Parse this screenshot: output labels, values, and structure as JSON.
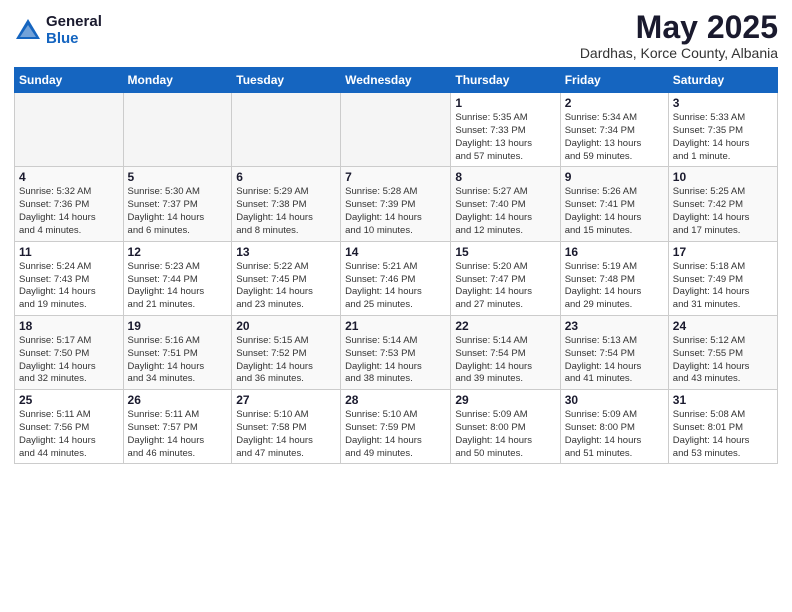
{
  "header": {
    "logo_general": "General",
    "logo_blue": "Blue",
    "main_title": "May 2025",
    "subtitle": "Dardhas, Korce County, Albania"
  },
  "weekdays": [
    "Sunday",
    "Monday",
    "Tuesday",
    "Wednesday",
    "Thursday",
    "Friday",
    "Saturday"
  ],
  "weeks": [
    [
      {
        "day": "",
        "info": ""
      },
      {
        "day": "",
        "info": ""
      },
      {
        "day": "",
        "info": ""
      },
      {
        "day": "",
        "info": ""
      },
      {
        "day": "1",
        "info": "Sunrise: 5:35 AM\nSunset: 7:33 PM\nDaylight: 13 hours\nand 57 minutes."
      },
      {
        "day": "2",
        "info": "Sunrise: 5:34 AM\nSunset: 7:34 PM\nDaylight: 13 hours\nand 59 minutes."
      },
      {
        "day": "3",
        "info": "Sunrise: 5:33 AM\nSunset: 7:35 PM\nDaylight: 14 hours\nand 1 minute."
      }
    ],
    [
      {
        "day": "4",
        "info": "Sunrise: 5:32 AM\nSunset: 7:36 PM\nDaylight: 14 hours\nand 4 minutes."
      },
      {
        "day": "5",
        "info": "Sunrise: 5:30 AM\nSunset: 7:37 PM\nDaylight: 14 hours\nand 6 minutes."
      },
      {
        "day": "6",
        "info": "Sunrise: 5:29 AM\nSunset: 7:38 PM\nDaylight: 14 hours\nand 8 minutes."
      },
      {
        "day": "7",
        "info": "Sunrise: 5:28 AM\nSunset: 7:39 PM\nDaylight: 14 hours\nand 10 minutes."
      },
      {
        "day": "8",
        "info": "Sunrise: 5:27 AM\nSunset: 7:40 PM\nDaylight: 14 hours\nand 12 minutes."
      },
      {
        "day": "9",
        "info": "Sunrise: 5:26 AM\nSunset: 7:41 PM\nDaylight: 14 hours\nand 15 minutes."
      },
      {
        "day": "10",
        "info": "Sunrise: 5:25 AM\nSunset: 7:42 PM\nDaylight: 14 hours\nand 17 minutes."
      }
    ],
    [
      {
        "day": "11",
        "info": "Sunrise: 5:24 AM\nSunset: 7:43 PM\nDaylight: 14 hours\nand 19 minutes."
      },
      {
        "day": "12",
        "info": "Sunrise: 5:23 AM\nSunset: 7:44 PM\nDaylight: 14 hours\nand 21 minutes."
      },
      {
        "day": "13",
        "info": "Sunrise: 5:22 AM\nSunset: 7:45 PM\nDaylight: 14 hours\nand 23 minutes."
      },
      {
        "day": "14",
        "info": "Sunrise: 5:21 AM\nSunset: 7:46 PM\nDaylight: 14 hours\nand 25 minutes."
      },
      {
        "day": "15",
        "info": "Sunrise: 5:20 AM\nSunset: 7:47 PM\nDaylight: 14 hours\nand 27 minutes."
      },
      {
        "day": "16",
        "info": "Sunrise: 5:19 AM\nSunset: 7:48 PM\nDaylight: 14 hours\nand 29 minutes."
      },
      {
        "day": "17",
        "info": "Sunrise: 5:18 AM\nSunset: 7:49 PM\nDaylight: 14 hours\nand 31 minutes."
      }
    ],
    [
      {
        "day": "18",
        "info": "Sunrise: 5:17 AM\nSunset: 7:50 PM\nDaylight: 14 hours\nand 32 minutes."
      },
      {
        "day": "19",
        "info": "Sunrise: 5:16 AM\nSunset: 7:51 PM\nDaylight: 14 hours\nand 34 minutes."
      },
      {
        "day": "20",
        "info": "Sunrise: 5:15 AM\nSunset: 7:52 PM\nDaylight: 14 hours\nand 36 minutes."
      },
      {
        "day": "21",
        "info": "Sunrise: 5:14 AM\nSunset: 7:53 PM\nDaylight: 14 hours\nand 38 minutes."
      },
      {
        "day": "22",
        "info": "Sunrise: 5:14 AM\nSunset: 7:54 PM\nDaylight: 14 hours\nand 39 minutes."
      },
      {
        "day": "23",
        "info": "Sunrise: 5:13 AM\nSunset: 7:54 PM\nDaylight: 14 hours\nand 41 minutes."
      },
      {
        "day": "24",
        "info": "Sunrise: 5:12 AM\nSunset: 7:55 PM\nDaylight: 14 hours\nand 43 minutes."
      }
    ],
    [
      {
        "day": "25",
        "info": "Sunrise: 5:11 AM\nSunset: 7:56 PM\nDaylight: 14 hours\nand 44 minutes."
      },
      {
        "day": "26",
        "info": "Sunrise: 5:11 AM\nSunset: 7:57 PM\nDaylight: 14 hours\nand 46 minutes."
      },
      {
        "day": "27",
        "info": "Sunrise: 5:10 AM\nSunset: 7:58 PM\nDaylight: 14 hours\nand 47 minutes."
      },
      {
        "day": "28",
        "info": "Sunrise: 5:10 AM\nSunset: 7:59 PM\nDaylight: 14 hours\nand 49 minutes."
      },
      {
        "day": "29",
        "info": "Sunrise: 5:09 AM\nSunset: 8:00 PM\nDaylight: 14 hours\nand 50 minutes."
      },
      {
        "day": "30",
        "info": "Sunrise: 5:09 AM\nSunset: 8:00 PM\nDaylight: 14 hours\nand 51 minutes."
      },
      {
        "day": "31",
        "info": "Sunrise: 5:08 AM\nSunset: 8:01 PM\nDaylight: 14 hours\nand 53 minutes."
      }
    ]
  ]
}
